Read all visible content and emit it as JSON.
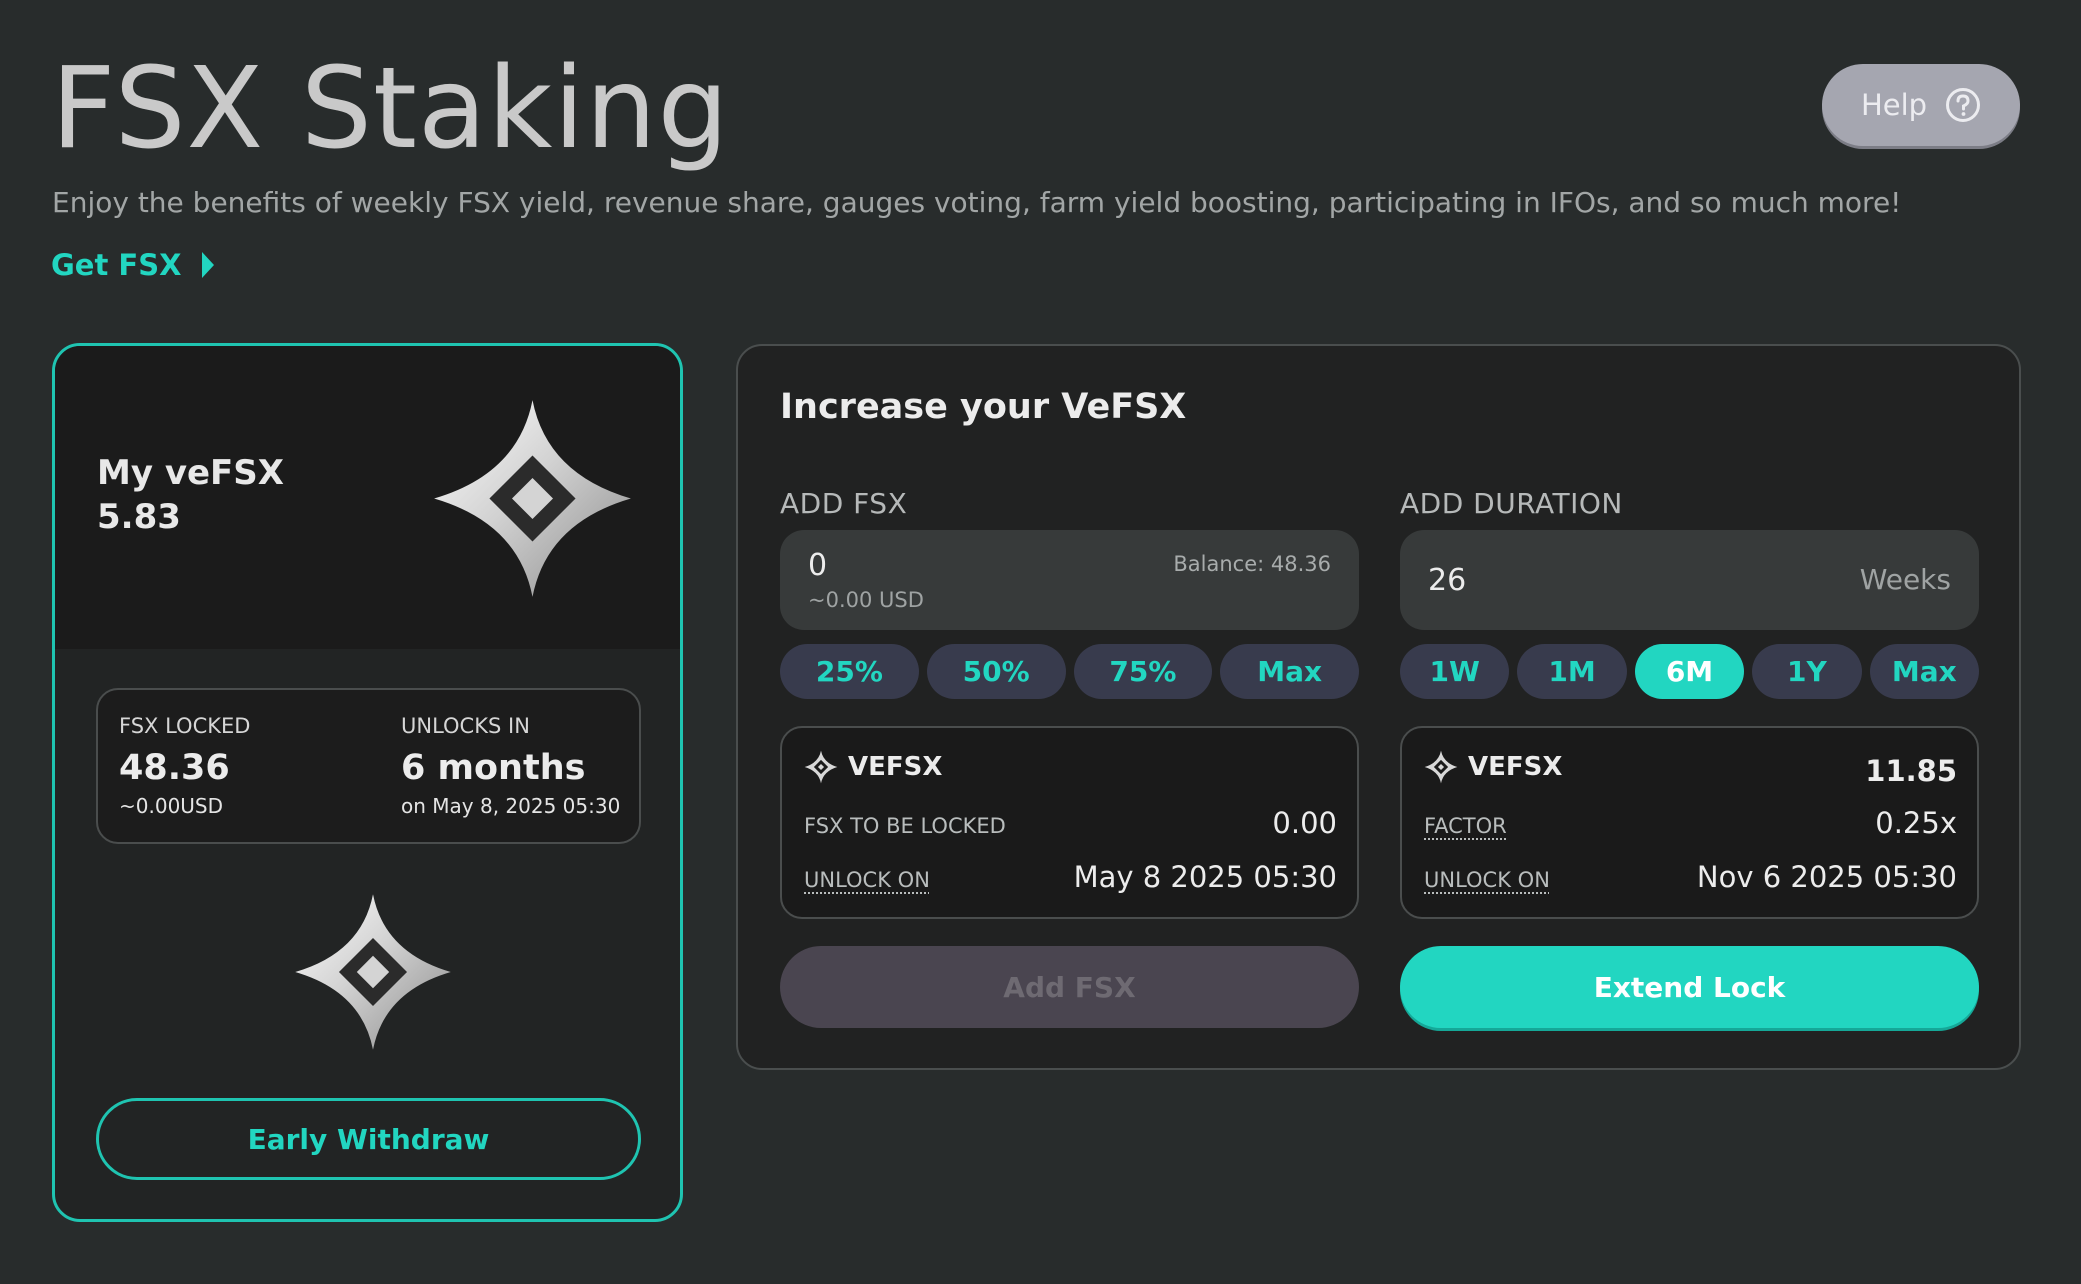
{
  "header": {
    "title": "FSX Staking",
    "subtitle": "Enjoy the benefits of weekly FSX yield, revenue share, gauges voting, farm yield boosting, participating in IFOs, and so much more!",
    "get_link": "Get FSX",
    "help_label": "Help"
  },
  "my_vefsx": {
    "label": "My veFSX",
    "value": "5.83",
    "locked_label": "FSX LOCKED",
    "locked_value": "48.36",
    "locked_usd": "~0.00USD",
    "unlocks_label": "UNLOCKS IN",
    "unlocks_value": "6 months",
    "unlocks_date": "on May 8, 2025 05:30",
    "withdraw_label": "Early Withdraw"
  },
  "increase": {
    "title": "Increase your VeFSX",
    "add_fsx": {
      "heading": "ADD FSX",
      "input_value": "0",
      "input_usd": "~0.00 USD",
      "balance": "Balance: 48.36",
      "chips": [
        "25%",
        "50%",
        "75%",
        "Max"
      ],
      "info_title": "VEFSX",
      "row1_label": "FSX TO BE LOCKED",
      "row1_value": "0.00",
      "row2_label": "UNLOCK ON",
      "row2_value": "May 8 2025 05:30",
      "button": "Add FSX"
    },
    "add_duration": {
      "heading": "ADD DURATION",
      "input_value": "26",
      "input_unit": "Weeks",
      "chips": [
        "1W",
        "1M",
        "6M",
        "1Y",
        "Max"
      ],
      "active_chip": "6M",
      "info_title": "VEFSX",
      "info_value": "11.85",
      "row1_label": "FACTOR",
      "row1_value": "0.25x",
      "row2_label": "UNLOCK ON",
      "row2_value": "Nov 6 2025 05:30",
      "button": "Extend Lock"
    }
  },
  "colors": {
    "accent": "#22d6c1",
    "background": "#282c2c"
  },
  "icons": [
    "chevron-right-icon",
    "help-circle-icon",
    "fsx-star-logo",
    "vefsx-icon"
  ]
}
